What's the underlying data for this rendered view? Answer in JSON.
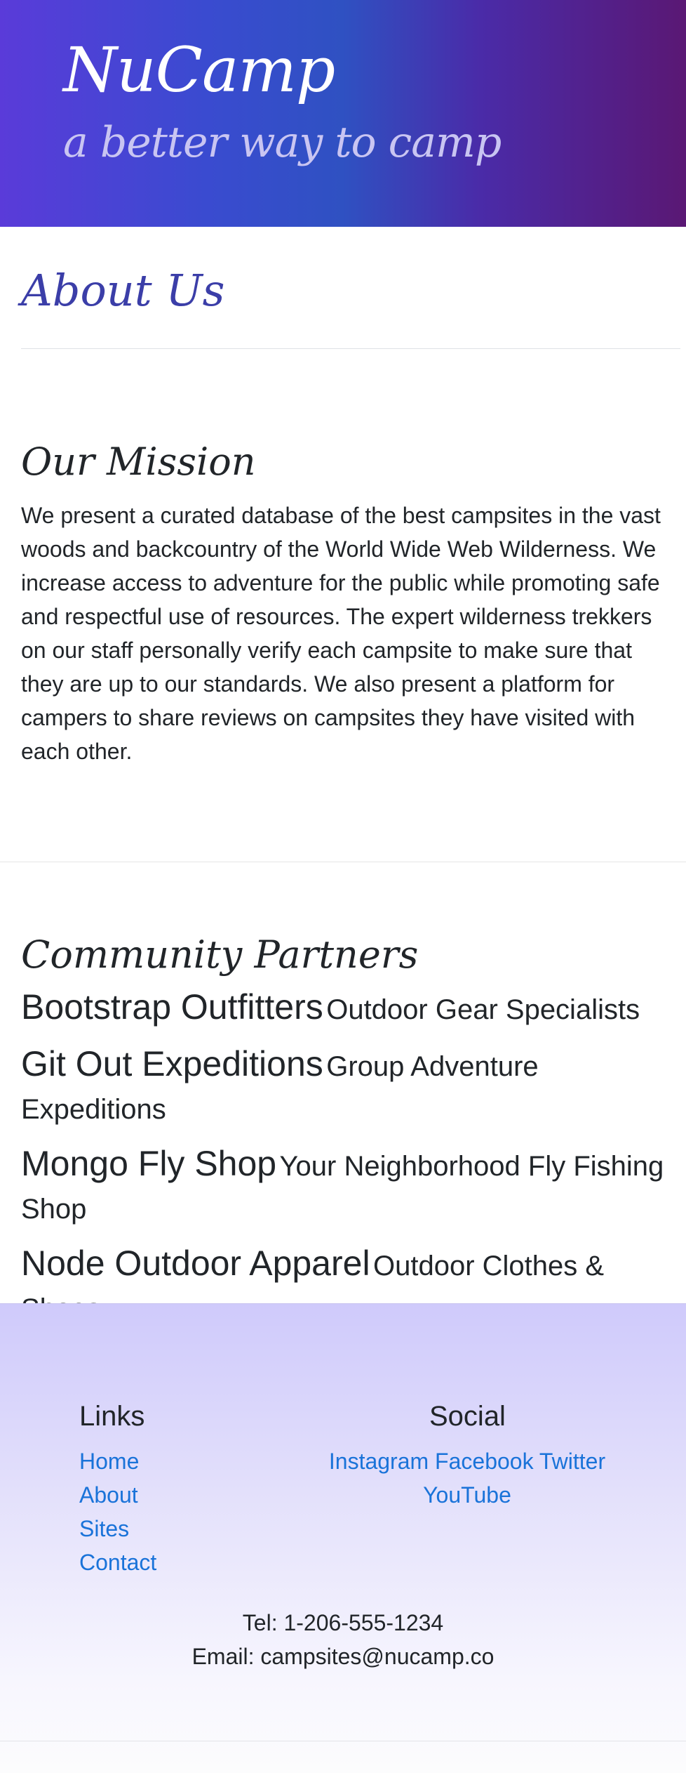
{
  "header": {
    "brand_title": "NuCamp",
    "tagline": "a better way to camp"
  },
  "about": {
    "title": "About Us"
  },
  "mission": {
    "heading": "Our Mission",
    "text": "We present a curated database of the best campsites in the vast woods and backcountry of the World Wide Web Wilderness. We increase access to adventure for the public while promoting safe and respectful use of resources. The expert wilderness trekkers on our staff personally verify each campsite to make sure that they are up to our standards. We also present a platform for campers to share reviews on campsites they have visited with each other."
  },
  "partners": {
    "heading": "Community Partners",
    "items": [
      {
        "name": "Bootstrap Outfitters",
        "desc": "Outdoor Gear Specialists"
      },
      {
        "name": "Git Out Expeditions",
        "desc": "Group Adventure Expeditions"
      },
      {
        "name": "Mongo Fly Shop",
        "desc": "Your Neighborhood Fly Fishing Shop"
      },
      {
        "name": "Node Outdoor Apparel",
        "desc": "Outdoor Clothes & Shoes"
      }
    ]
  },
  "footer": {
    "links_title": "Links",
    "links": [
      "Home",
      "About",
      "Sites",
      "Contact"
    ],
    "social_title": "Social",
    "social": [
      "Instagram",
      "Facebook",
      "Twitter",
      "YouTube"
    ],
    "tel": "Tel: 1-206-555-1234",
    "email": "Email: campsites@nucamp.co"
  },
  "colors": {
    "brand_accent": "#3b3ea8",
    "link": "#1a73d9",
    "header_gradient_start": "#5a3bd9",
    "header_gradient_end": "#5a1874",
    "footer_gradient_top": "#cfcafb"
  }
}
